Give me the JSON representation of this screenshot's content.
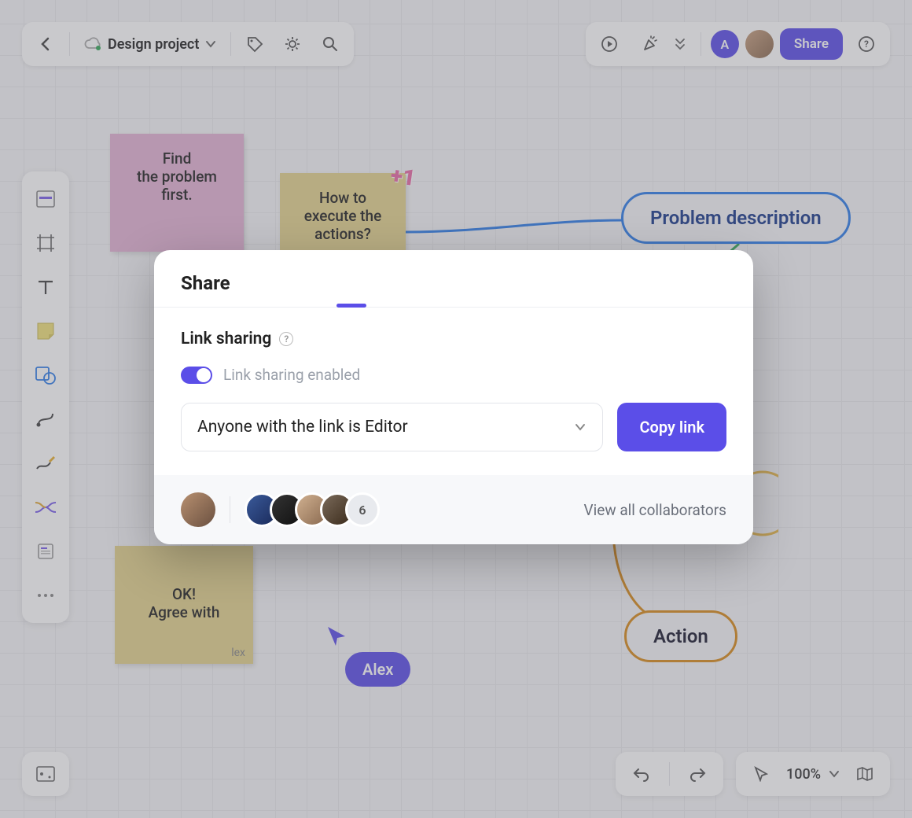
{
  "project": {
    "name": "Design project"
  },
  "topbar": {
    "share_label": "Share"
  },
  "zoom": {
    "level": "100%"
  },
  "avatars": {
    "initial": "A"
  },
  "canvas": {
    "sticky_pink": "Find\nthe problem\nfirst.",
    "sticky_yellow": "How to\nexecute the\nactions?",
    "sticky_ok": "OK!\nAgree with",
    "sticky_ok_author": "lex",
    "bubble_problem": "Problem description",
    "bubble_action": "Action",
    "plusone": "+1",
    "cursor_label": "Alex"
  },
  "share_modal": {
    "title": "Share",
    "section": "Link sharing",
    "toggle_label": "Link sharing enabled",
    "access_option": "Anyone with the link is Editor",
    "copy_label": "Copy link",
    "extra_count": "6",
    "view_all": "View all collaborators"
  }
}
